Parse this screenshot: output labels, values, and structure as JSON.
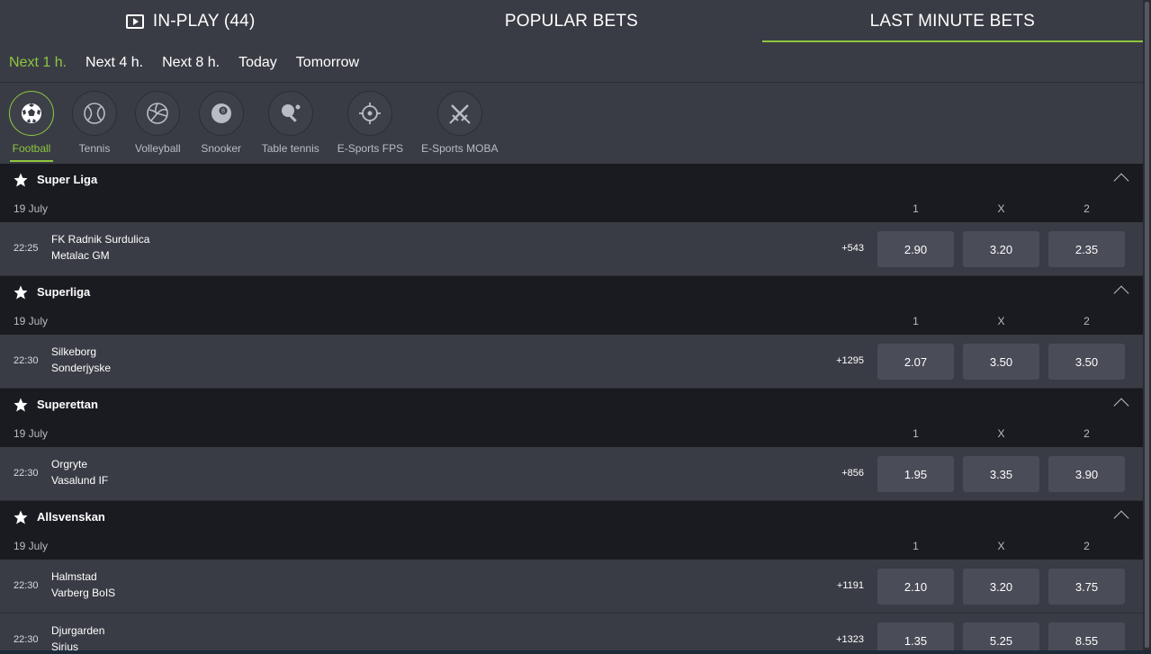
{
  "top_tabs": [
    {
      "label": "IN-PLAY (44)",
      "icon": "play-icon",
      "active": false
    },
    {
      "label": "POPULAR BETS",
      "active": false
    },
    {
      "label": "LAST MINUTE BETS",
      "active": true
    }
  ],
  "time_filters": [
    {
      "label": "Next 1 h.",
      "active": true
    },
    {
      "label": "Next 4 h.",
      "active": false
    },
    {
      "label": "Next 8 h.",
      "active": false
    },
    {
      "label": "Today",
      "active": false
    },
    {
      "label": "Tomorrow",
      "active": false
    }
  ],
  "sports": [
    {
      "label": "Football",
      "icon": "football-icon",
      "active": true
    },
    {
      "label": "Tennis",
      "icon": "tennis-icon",
      "active": false
    },
    {
      "label": "Volleyball",
      "icon": "volleyball-icon",
      "active": false
    },
    {
      "label": "Snooker",
      "icon": "snooker-icon",
      "active": false
    },
    {
      "label": "Table tennis",
      "icon": "table-tennis-icon",
      "active": false
    },
    {
      "label": "E-Sports FPS",
      "icon": "crosshair-icon",
      "active": false
    },
    {
      "label": "E-Sports MOBA",
      "icon": "swords-icon",
      "active": false
    }
  ],
  "columns": [
    "1",
    "X",
    "2"
  ],
  "leagues": [
    {
      "name": "Super Liga",
      "date": "19 July",
      "matches": [
        {
          "time": "22:25",
          "home": "FK Radnik Surdulica",
          "away": "Metalac GM",
          "more": "+543",
          "odds": [
            "2.90",
            "3.20",
            "2.35"
          ]
        }
      ]
    },
    {
      "name": "Superliga",
      "date": "19 July",
      "matches": [
        {
          "time": "22:30",
          "home": "Silkeborg",
          "away": "Sonderjyske",
          "more": "+1295",
          "odds": [
            "2.07",
            "3.50",
            "3.50"
          ]
        }
      ]
    },
    {
      "name": "Superettan",
      "date": "19 July",
      "matches": [
        {
          "time": "22:30",
          "home": "Orgryte",
          "away": "Vasalund IF",
          "more": "+856",
          "odds": [
            "1.95",
            "3.35",
            "3.90"
          ]
        }
      ]
    },
    {
      "name": "Allsvenskan",
      "date": "19 July",
      "matches": [
        {
          "time": "22:30",
          "home": "Halmstad",
          "away": "Varberg BoIS",
          "more": "+1191",
          "odds": [
            "2.10",
            "3.20",
            "3.75"
          ]
        },
        {
          "time": "22:30",
          "home": "Djurgarden",
          "away": "Sirius",
          "more": "+1323",
          "odds": [
            "1.35",
            "5.25",
            "8.55"
          ]
        }
      ]
    }
  ],
  "colors": {
    "accent": "#8dc63f",
    "header_bg": "#1a1b21",
    "row_bg": "#3a3c45",
    "odd_bg": "#4a4c57"
  }
}
